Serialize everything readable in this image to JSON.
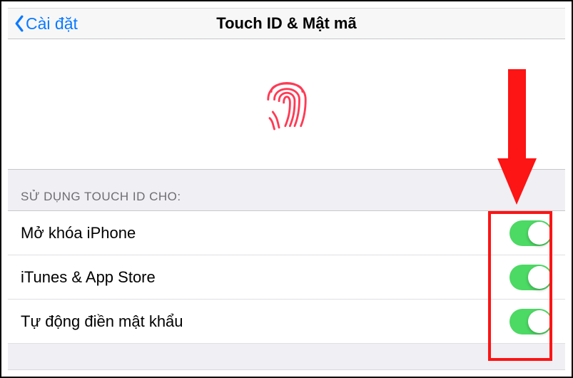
{
  "nav": {
    "back_label": "Cài đặt",
    "title": "Touch ID & Mật mã"
  },
  "section_header": "SỬ DỤNG TOUCH ID CHO:",
  "rows": {
    "unlock": "Mở khóa iPhone",
    "itunes": "iTunes & App Store",
    "autofill": "Tự động điền mật khẩu"
  }
}
